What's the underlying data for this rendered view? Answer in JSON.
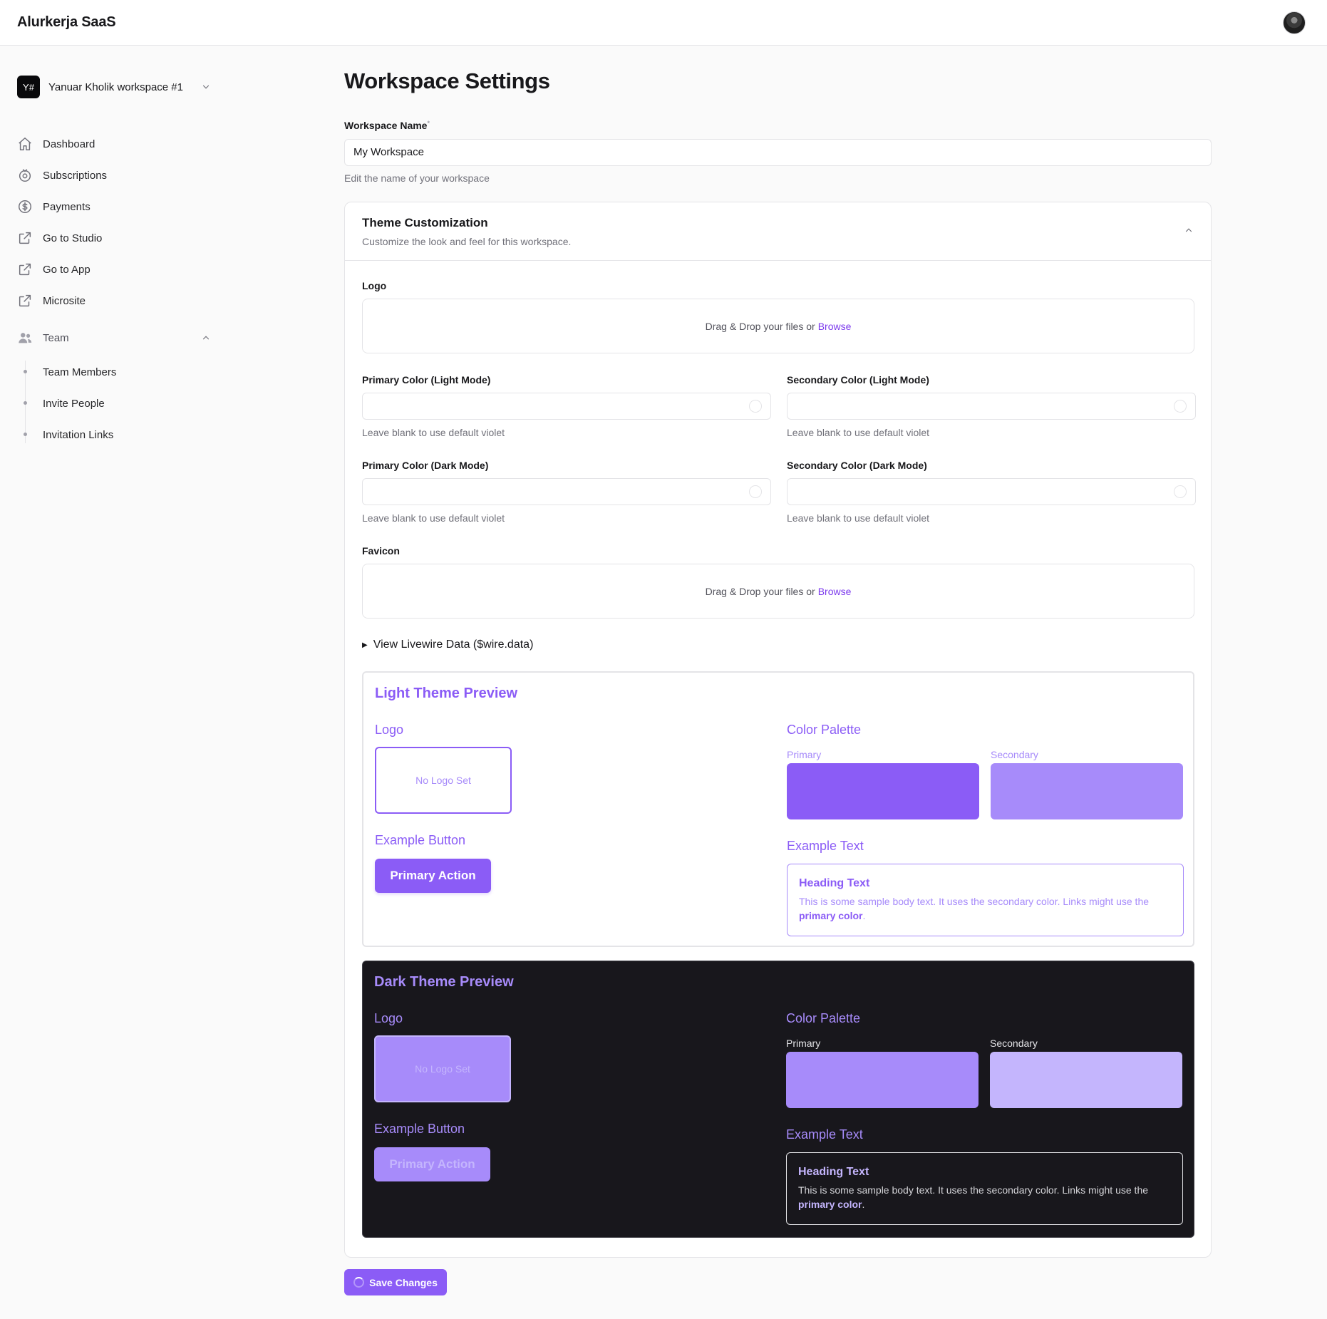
{
  "app": {
    "brand": "Alurkerja SaaS"
  },
  "sidebar": {
    "workspace": {
      "badge": "Y#",
      "name": "Yanuar Kholik workspace #1"
    },
    "items": [
      {
        "label": "Dashboard",
        "icon": "home-icon"
      },
      {
        "label": "Subscriptions",
        "icon": "subscriptions-icon"
      },
      {
        "label": "Payments",
        "icon": "dollar-circle-icon"
      },
      {
        "label": "Go to Studio",
        "icon": "external-link-icon"
      },
      {
        "label": "Go to App",
        "icon": "external-link-icon"
      },
      {
        "label": "Microsite",
        "icon": "external-link-icon"
      }
    ],
    "team": {
      "label": "Team",
      "icon": "users-icon",
      "items": [
        {
          "label": "Team Members"
        },
        {
          "label": "Invite People"
        },
        {
          "label": "Invitation Links"
        }
      ]
    }
  },
  "main": {
    "title": "Workspace Settings",
    "workspace_name": {
      "label": "Workspace Name",
      "required_mark": "*",
      "value": "My Workspace",
      "hint": "Edit the name of your workspace"
    },
    "theme": {
      "title": "Theme Customization",
      "subtitle": "Customize the look and feel for this workspace.",
      "logo": {
        "label": "Logo",
        "drop_text": "Drag & Drop your files or",
        "browse": "Browse"
      },
      "primary_light": {
        "label": "Primary Color (Light Mode)",
        "value": "",
        "hint": "Leave blank to use default violet"
      },
      "secondary_light": {
        "label": "Secondary Color (Light Mode)",
        "value": "",
        "hint": "Leave blank to use default violet"
      },
      "primary_dark": {
        "label": "Primary Color (Dark Mode)",
        "value": "",
        "hint": "Leave blank to use default violet"
      },
      "secondary_dark": {
        "label": "Secondary Color (Dark Mode)",
        "value": "",
        "hint": "Leave blank to use default violet"
      },
      "favicon": {
        "label": "Favicon",
        "drop_text": "Drag & Drop your files or",
        "browse": "Browse"
      },
      "debug_toggle": "View Livewire Data ($wire.data)"
    },
    "light_preview": {
      "title": "Light Theme Preview",
      "logo_heading": "Logo",
      "no_logo": "No Logo Set",
      "button_heading": "Example Button",
      "button_label": "Primary Action",
      "palette_heading": "Color Palette",
      "primary_label": "Primary",
      "secondary_label": "Secondary",
      "primary_color": "#8b5cf6",
      "secondary_color": "#a78bfa",
      "text_heading": "Example Text",
      "sample_heading": "Heading Text",
      "sample_body": "This is some sample body text. It uses the secondary color. Links might use the",
      "sample_link": "primary color",
      "sample_end": "."
    },
    "dark_preview": {
      "title": "Dark Theme Preview",
      "logo_heading": "Logo",
      "no_logo": "No Logo Set",
      "button_heading": "Example Button",
      "button_label": "Primary Action",
      "palette_heading": "Color Palette",
      "primary_label": "Primary",
      "secondary_label": "Secondary",
      "primary_color": "#a78bfa",
      "secondary_color": "#c4b5fd",
      "text_heading": "Example Text",
      "sample_heading": "Heading Text",
      "sample_body": "This is some sample body text. It uses the secondary color. Links might use the",
      "sample_link": "primary color",
      "sample_end": "."
    },
    "save_label": "Save Changes"
  }
}
